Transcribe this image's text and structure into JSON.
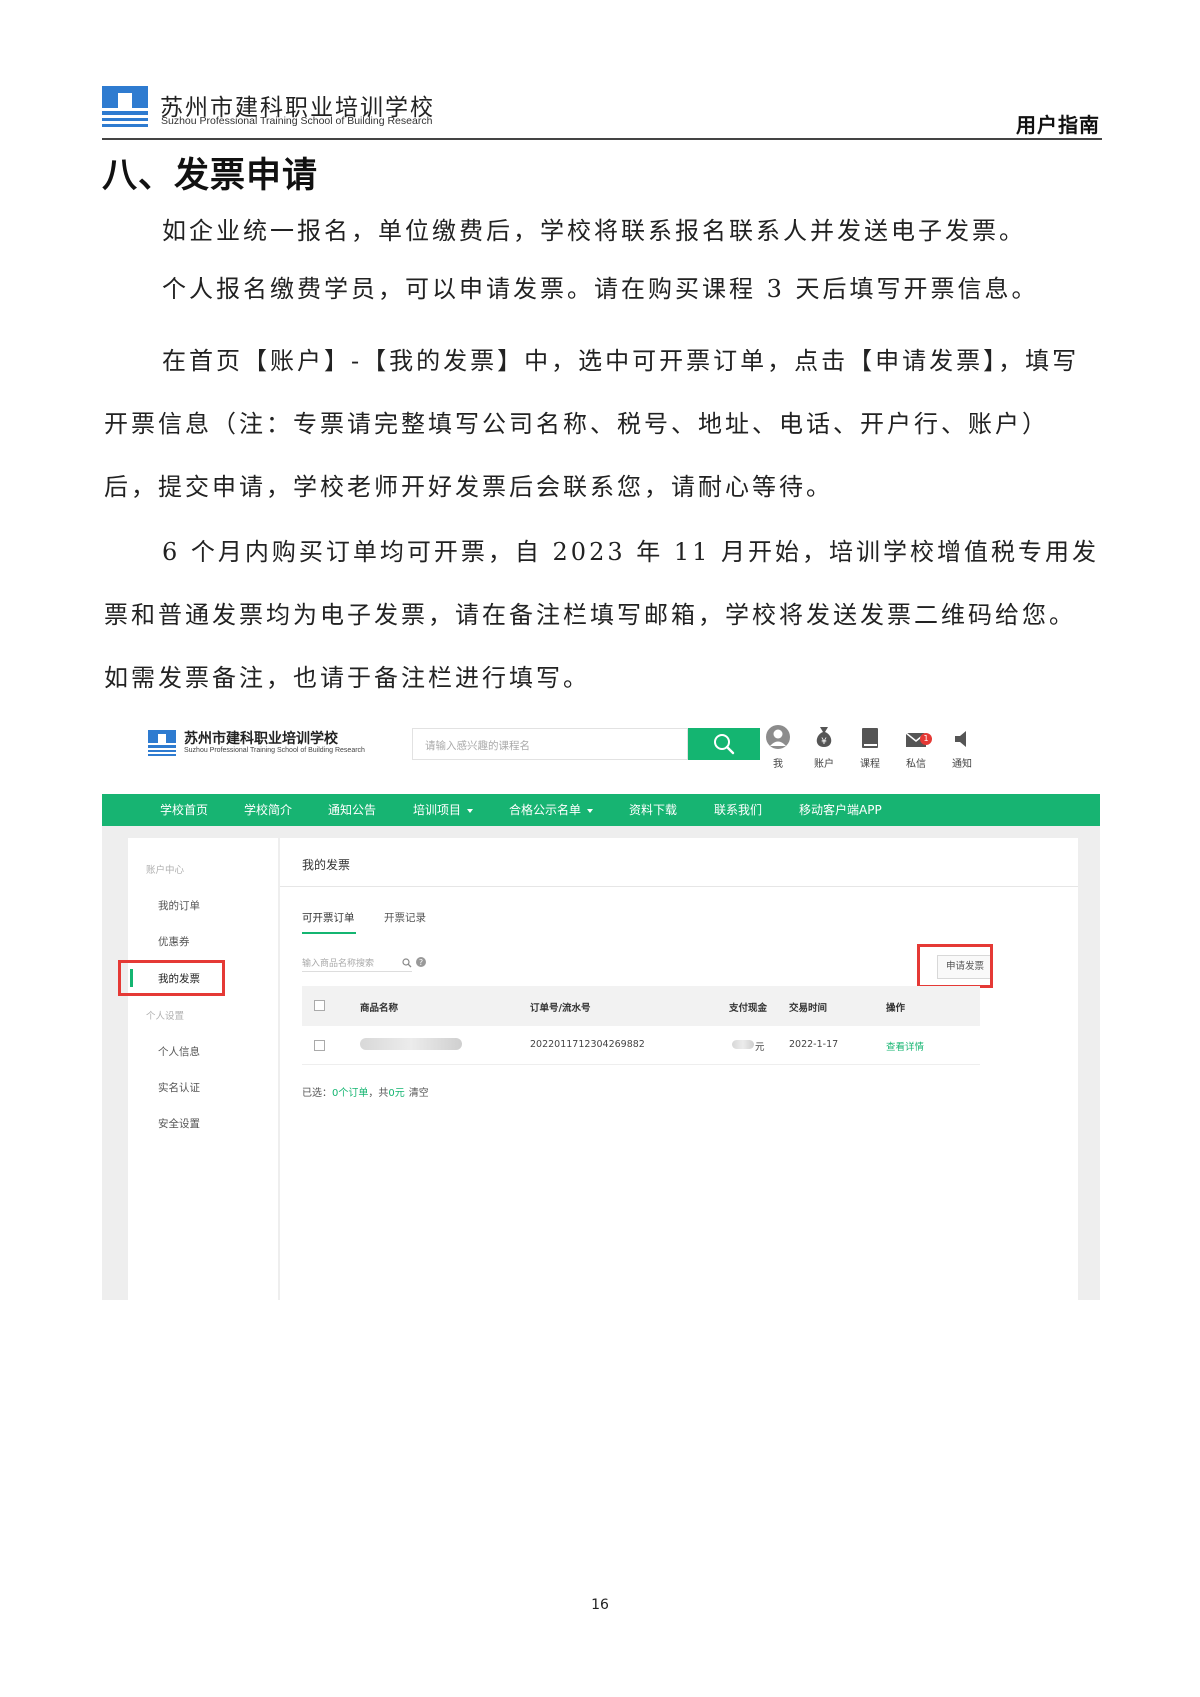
{
  "header": {
    "school_name": "苏州市建科职业培训学校",
    "school_name_en": "Suzhou Professional Training School of Building Research",
    "doc_label": "用户指南"
  },
  "title": "八、发票申请",
  "paragraphs": [
    "如企业统一报名，单位缴费后，学校将联系报名联系人并发送电子发票。",
    "个人报名缴费学员，可以申请发票。请在购买课程 3 天后填写开票信息。",
    "在首页【账户】-【我的发票】中，选中可开票订单，点击【申请发票】，填写开票信息（注：专票请完整填写公司名称、税号、地址、电话、开户行、账户）后，提交申请，学校老师开好发票后会联系您，请耐心等待。",
    "6 个月内购买订单均可开票，自 2023 年 11 月开始，培训学校增值税专用发票和普通发票均为电子发票，请在备注栏填写邮箱，学校将发送发票二维码给您。如需发票备注，也请于备注栏进行填写。"
  ],
  "screenshot": {
    "logo_name": "苏州市建科职业培训学校",
    "logo_name_en": "Suzhou Professional Training School of Building Research",
    "search_placeholder": "请输入感兴趣的课程名",
    "toolbar": [
      {
        "label": "我",
        "icon": "user-avatar-icon"
      },
      {
        "label": "账户",
        "icon": "money-bag-icon"
      },
      {
        "label": "课程",
        "icon": "book-icon"
      },
      {
        "label": "私信",
        "icon": "mail-icon",
        "badge": "1"
      },
      {
        "label": "通知",
        "icon": "speaker-icon"
      }
    ],
    "nav": [
      "学校首页",
      "学校简介",
      "通知公告",
      "培训项目",
      "合格公示名单",
      "资料下载",
      "联系我们",
      "移动客户端APP"
    ],
    "sidebar": {
      "group1": "账户中心",
      "items1": [
        "我的订单",
        "优惠券",
        "我的发票"
      ],
      "group2": "个人设置",
      "items2": [
        "个人信息",
        "实名认证",
        "安全设置"
      ]
    },
    "main": {
      "title": "我的发票",
      "tabs": [
        "可开票订单",
        "开票记录"
      ],
      "filter_placeholder": "输入商品名称搜索",
      "apply_button": "申请发票",
      "columns": [
        "商品名称",
        "订单号/流水号",
        "支付现金",
        "交易时间",
        "操作"
      ],
      "rows": [
        {
          "order_no": "202201171230426988​2",
          "amount_suffix": "元",
          "time": "2022-1-17",
          "action": "查看详情"
        }
      ],
      "summary_prefix": "已选：",
      "summary_orders": "0个订单",
      "summary_total_prefix": "，共",
      "summary_total": "0元",
      "summary_clear": "清空"
    }
  },
  "page_number": "16",
  "colors": {
    "accent": "#17b472",
    "highlight": "#e53935",
    "logo_blue": "#2e7bd0"
  }
}
